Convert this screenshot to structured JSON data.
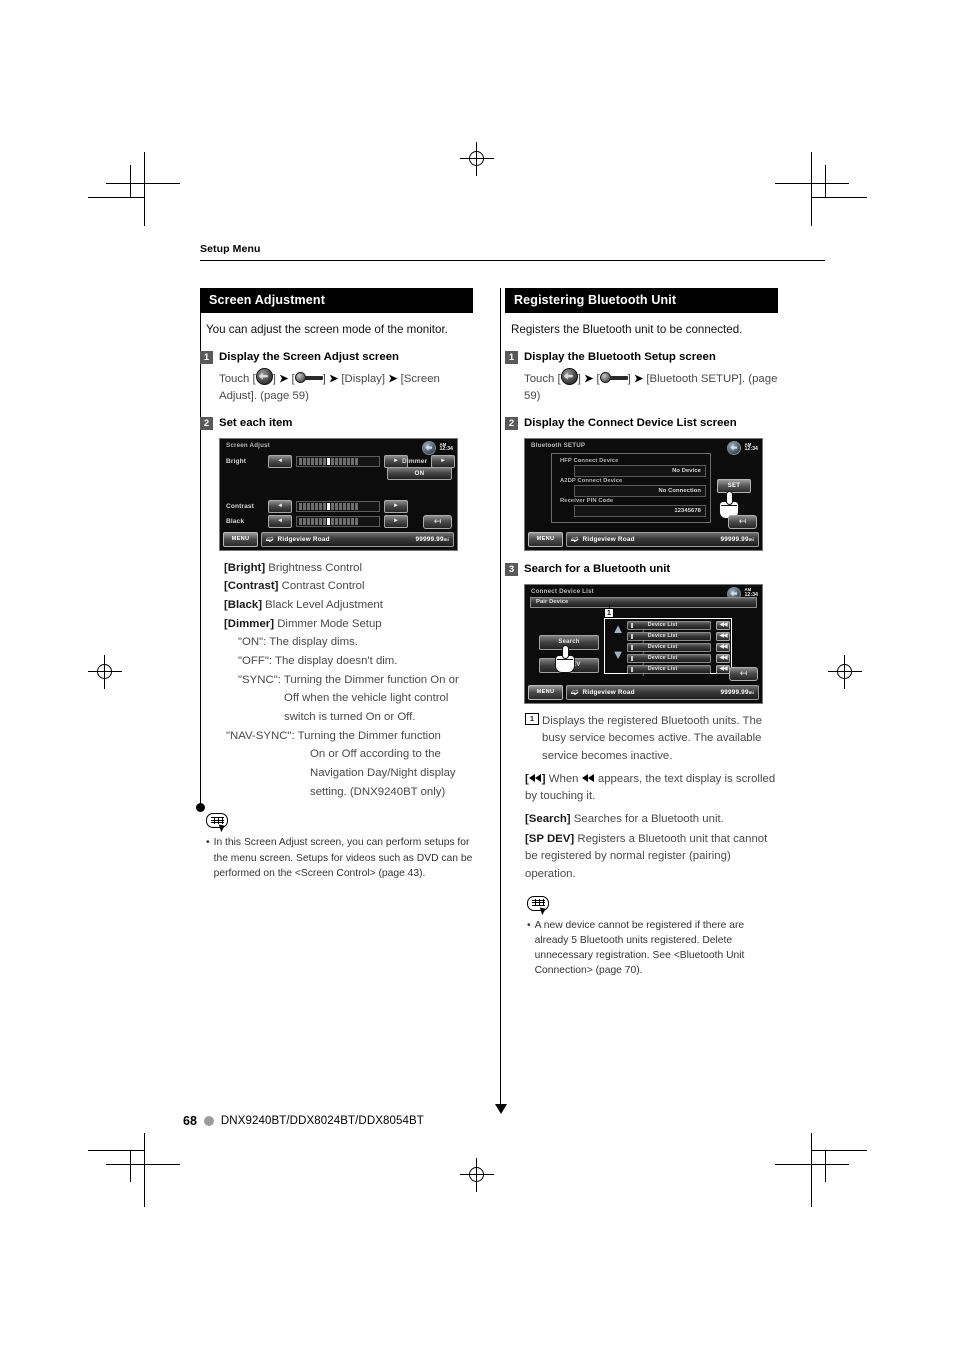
{
  "running_head": "Setup Menu",
  "footer": {
    "page_number": "68",
    "models": "DNX9240BT/DDX8024BT/DDX8054BT"
  },
  "left_column": {
    "banner": "Screen Adjustment",
    "intro": "You can adjust the screen mode of the monitor.",
    "step1": {
      "number": "1",
      "title": "Display the Screen Adjust screen",
      "body_prefix": "Touch [",
      "body_mid1": "] ",
      "body_chev": "➤",
      "body_mid2": " [",
      "body_mid3": "] ",
      "body_display": " [Display] ",
      "body_screen": " [Screen Adjust]. (page 59)"
    },
    "step2": {
      "number": "2",
      "title": "Set each item"
    },
    "device": {
      "title": "Screen Adjust",
      "clock_ampm": "AM",
      "clock_time": "12:34",
      "bright_label": "Bright",
      "contrast_label": "Contrast",
      "black_label": "Black",
      "dimmer_label": "Dimmer",
      "dimmer_value": "ON",
      "menu_label": "MENU",
      "road_name": "Ridgeview Road",
      "distance": "99999.99",
      "distance_unit": "mi"
    },
    "definitions": [
      {
        "term": "[Bright]",
        "desc": "Brightness Control"
      },
      {
        "term": "[Contrast]",
        "desc": "Contrast Control"
      },
      {
        "term": "[Black]",
        "desc": "Black Level Adjustment"
      },
      {
        "term": "[Dimmer]",
        "desc": "Dimmer Mode Setup"
      }
    ],
    "dimmer_options": [
      "\"ON\": The display dims.",
      "\"OFF\": The display doesn't dim.",
      "\"SYNC\": Turning the Dimmer function On or",
      "Off when the vehicle light control",
      "switch is turned On or Off.",
      "\"NAV-SYNC\": Turning the Dimmer function",
      "On or Off according to the",
      "Navigation Day/Night display",
      "setting. (DNX9240BT only)"
    ],
    "note": {
      "bullet": "•",
      "text": "In this Screen Adjust screen, you can perform setups for the menu screen. Setups for videos such as DVD can be performed on the <Screen Control> (page 43)."
    }
  },
  "right_column": {
    "banner": "Registering Bluetooth Unit",
    "intro": "Registers the Bluetooth unit to be connected.",
    "step1": {
      "number": "1",
      "title": "Display the Bluetooth Setup screen",
      "body_prefix": "Touch [",
      "body_mid2": " [",
      "body_tail": " [Bluetooth SETUP]. (page 59)"
    },
    "step2": {
      "number": "2",
      "title": "Display the Connect Device List screen"
    },
    "step3": {
      "number": "3",
      "title": "Search for a Bluetooth unit"
    },
    "device_bt": {
      "title": "Bluetooth SETUP",
      "clock_ampm": "AM",
      "clock_time": "12:34",
      "hfp_label": "HFP Connect Device",
      "hfp_value": "No Device",
      "a2dp_label": "A2DP Connect Device",
      "a2dp_value": "No Connection",
      "pin_label": "Receiver PIN Code",
      "pin_value": "12345678",
      "set_button": "SET",
      "menu_label": "MENU",
      "road_name": "Ridgeview Road",
      "distance": "99999.99",
      "distance_unit": "mi"
    },
    "device_cdl": {
      "title": "Connect Device List",
      "clock_ampm": "AM",
      "clock_time": "12:34",
      "pair_device": "Pair Device",
      "callout": "1",
      "search_button": "Search",
      "spdev_button": "SP DEV",
      "device_rows": [
        "Device List",
        "Device List",
        "Device List",
        "Device List",
        "Device List"
      ],
      "menu_label": "MENU",
      "road_name": "Ridgeview Road",
      "distance": "99999.99",
      "distance_unit": "mi"
    },
    "callout_desc": {
      "number": "1",
      "text": "Displays the registered Bluetooth units. The busy service becomes active. The available service becomes inactive."
    },
    "rew_desc": {
      "prefix": "[",
      "suffix": "]",
      "text_a": "When",
      "text_b": "appears, the text display is scrolled by touching it."
    },
    "definitions": [
      {
        "term": "[Search]",
        "desc": "Searches for a Bluetooth unit."
      },
      {
        "term": "[SP DEV]",
        "desc": "Registers a Bluetooth unit that cannot be registered by normal register (pairing) operation."
      }
    ],
    "note": {
      "bullet": "•",
      "text": "A new device cannot be registered if there are already 5 Bluetooth units registered. Delete unnecessary registration. See <Bluetooth Unit Connection> (page 70)."
    }
  }
}
